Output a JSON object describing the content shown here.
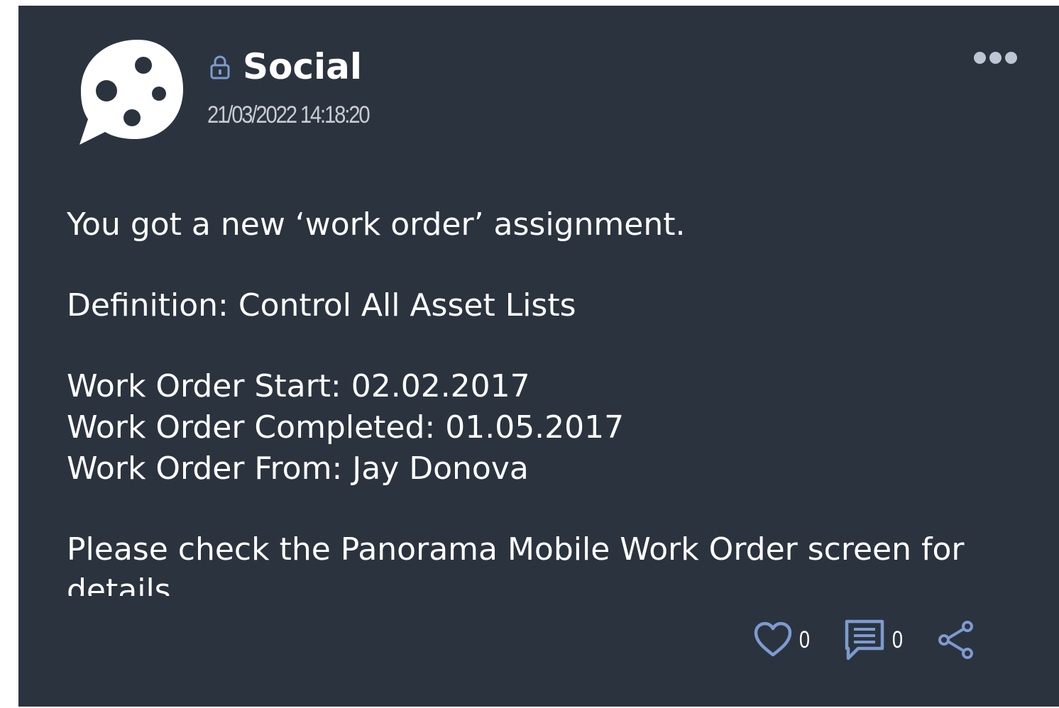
{
  "post": {
    "avatar_icon": "chat-bubble-dots-icon",
    "privacy_icon": "lock-icon",
    "title": "Social",
    "timestamp": "21/03/2022 14:18:20",
    "menu_icon": "more-horizontal-icon",
    "body": {
      "line1": "You got a new ‘work order’ assignment.",
      "line2": "Definition: Control All Asset Lists",
      "line3": "Work Order Start: 02.02.2017",
      "line4": "Work Order Completed: 01.05.2017",
      "line5": "Work Order From: Jay Donova",
      "line6": "Please check the Panorama Mobile Work Order screen for details."
    },
    "actions": {
      "like_icon": "heart-outline-icon",
      "like_count": "0",
      "comment_icon": "comment-icon",
      "comment_count": "0",
      "share_icon": "share-icon"
    }
  },
  "colors": {
    "card_background": "#2b333e",
    "text": "#ffffff",
    "timestamp": "#c8ccd2",
    "icon_accent": "#7d9bd0",
    "menu_dots": "#bcc6d4"
  }
}
